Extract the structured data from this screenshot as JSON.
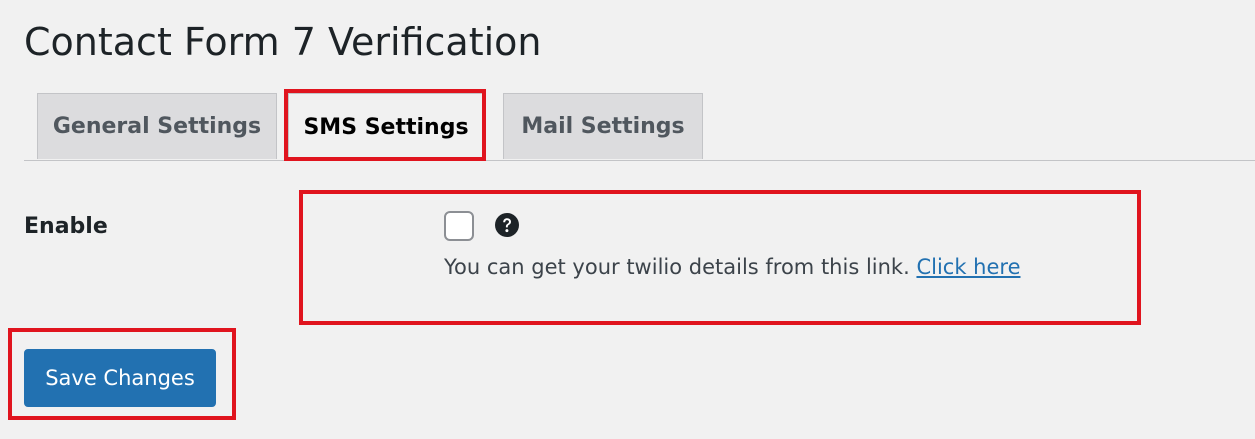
{
  "page": {
    "title": "Contact Form 7 Verification"
  },
  "tabs": [
    {
      "label": "General Settings",
      "active": false
    },
    {
      "label": "SMS Settings",
      "active": true
    },
    {
      "label": "Mail Settings",
      "active": false
    }
  ],
  "form": {
    "enable_label": "Enable",
    "enable_checked": false,
    "description_text": "You can get your twilio details from this link.",
    "link_text": "Click here",
    "save_label": "Save Changes"
  },
  "icons": {
    "help": "question-circle-icon"
  },
  "colors": {
    "background": "#f1f1f1",
    "primary": "#2271b1",
    "highlight": "#e0141e",
    "inactive_tab": "#dcdcde",
    "text": "#1d2327"
  }
}
